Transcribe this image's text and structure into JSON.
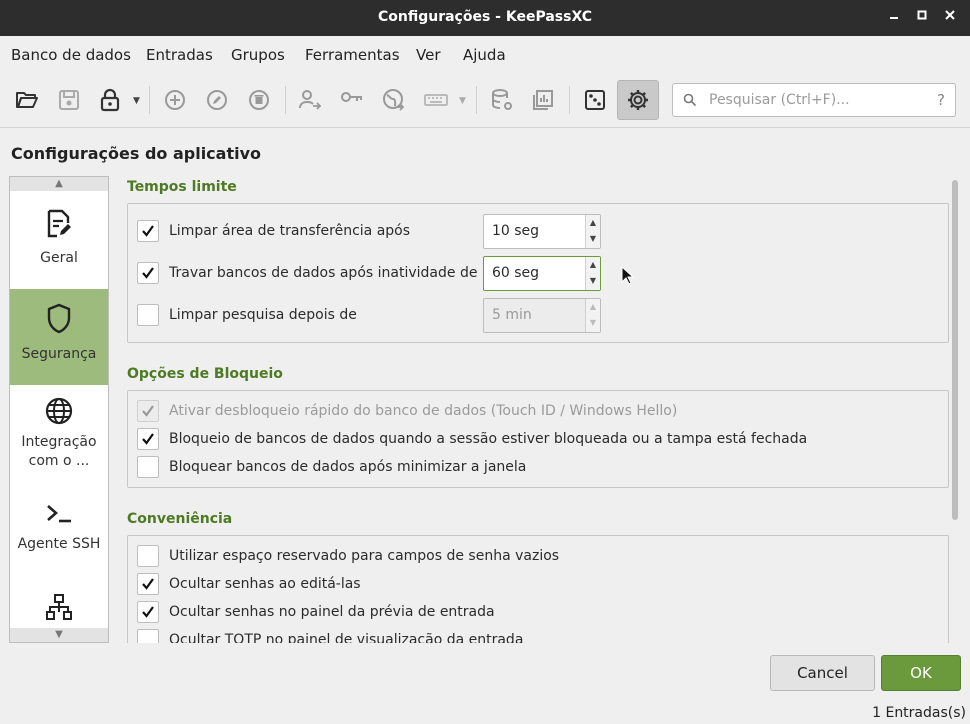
{
  "window": {
    "title": "Configurações - KeePassXC"
  },
  "menu": [
    "Banco de dados",
    "Entradas",
    "Grupos",
    "Ferramentas",
    "Ver",
    "Ajuda"
  ],
  "search": {
    "placeholder": "Pesquisar (Ctrl+F)...",
    "help": "?"
  },
  "page_title": "Configurações do aplicativo",
  "categories": [
    {
      "label": "Geral",
      "icon": "document-edit-icon",
      "active": false
    },
    {
      "label": "Segurança",
      "icon": "shield-icon",
      "active": true
    },
    {
      "label": "Integração com o ...",
      "icon": "globe-icon",
      "active": false
    },
    {
      "label": "Agente SSH",
      "icon": "terminal-icon",
      "active": false
    },
    {
      "label": "",
      "icon": "network-icon",
      "active": false
    }
  ],
  "timeouts": {
    "title": "Tempos limite",
    "rows": [
      {
        "label": "Limpar área de transferência após",
        "checked": true,
        "value": "10 seg"
      },
      {
        "label": "Travar bancos de dados após inatividade de",
        "checked": true,
        "value": "60 seg"
      },
      {
        "label": "Limpar pesquisa depois de",
        "checked": false,
        "value": "5 min"
      }
    ]
  },
  "lock": {
    "title": "Opções de Bloqueio",
    "rows": [
      {
        "label": "Ativar desbloqueio rápido do banco de dados (Touch ID / Windows Hello)",
        "checked": true,
        "disabled": true
      },
      {
        "label": "Bloqueio de bancos de dados quando a sessão estiver bloqueada ou a tampa está fechada",
        "checked": true
      },
      {
        "label": "Bloquear bancos de dados após minimizar a janela",
        "checked": false
      }
    ]
  },
  "convenience": {
    "title": "Conveniência",
    "rows": [
      {
        "label": "Utilizar espaço reservado para campos de senha vazios",
        "checked": false
      },
      {
        "label": "Ocultar senhas ao editá-las",
        "checked": true
      },
      {
        "label": "Ocultar senhas no painel da prévia de entrada",
        "checked": true
      },
      {
        "label": "Ocultar TOTP no painel de visualização da entrada",
        "checked": false
      }
    ]
  },
  "buttons": {
    "cancel": "Cancel",
    "ok": "OK"
  },
  "status": "1 Entradas(s)",
  "colors": {
    "accent": "#6b9a3d",
    "group_title": "#4d7a22",
    "active_category": "#9dbb7c",
    "titlebar": "#2d2d2d"
  }
}
